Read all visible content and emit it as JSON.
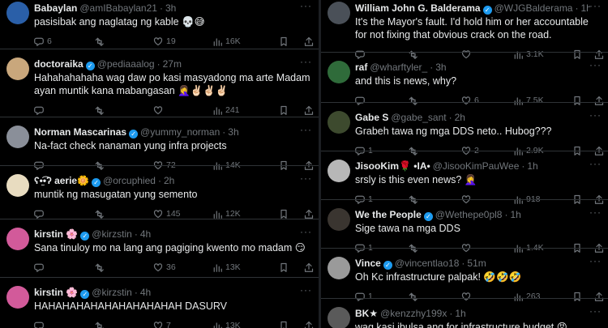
{
  "left_column": [
    {
      "name": "Babaylan",
      "verified": false,
      "handle": "@amIBabaylan21",
      "time": "3h",
      "text": "pasisibak ang naglatag ng kable 💀😅",
      "replies": "6",
      "reposts": "",
      "likes": "19",
      "views": "16K",
      "avatar_color": "#2a5fa8"
    },
    {
      "name": "doctoraika",
      "verified": true,
      "handle": "@pediaaalog",
      "time": "27m",
      "text": "Hahahahahaha wag daw po kasi masyadong ma arte Madam ayan muntik kana mabangasan 🤦‍♀️✌🏻✌🏻✌🏻",
      "replies": "",
      "reposts": "",
      "likes": "",
      "views": "241",
      "avatar_color": "#c9a77c"
    },
    {
      "name": "Norman Mascarinas",
      "verified": true,
      "handle": "@yummy_norman",
      "time": "3h",
      "text": "Na-fact check nanaman yung infra projects",
      "replies": "",
      "reposts": "",
      "likes": "72",
      "views": "14K",
      "avatar_color": "#8a8f99"
    },
    {
      "name": "ʕ•̫͡•ʔ aerie🌼",
      "verified": true,
      "handle": "@orcuphied",
      "time": "2h",
      "text": "muntik ng masugatan yung semento",
      "replies": "",
      "reposts": "",
      "likes": "145",
      "views": "12K",
      "avatar_color": "#e8dcc0"
    },
    {
      "name": "kirstin 🌸",
      "verified": true,
      "handle": "@kirzstin",
      "time": "4h",
      "text": "Sana tinuloy mo na lang ang pagiging kwento mo madam 😏",
      "replies": "",
      "reposts": "",
      "likes": "36",
      "views": "13K",
      "avatar_color": "#d25a9a"
    },
    {
      "name": "kirstin 🌸",
      "verified": true,
      "handle": "@kirzstin",
      "time": "4h",
      "text": "HAHAHAHAHAHAHAHAHAHAH DASURV",
      "replies": "",
      "reposts": "",
      "likes": "7",
      "views": "13K",
      "avatar_color": "#d25a9a"
    }
  ],
  "right_column": [
    {
      "name": "William John G. Balderama",
      "verified": true,
      "handle": "@WJGBalderama",
      "time": "1h",
      "text": "It's the Mayor's fault. I'd hold him or her accountable for not fixing that obvious crack on the road.",
      "replies": "",
      "reposts": "",
      "likes": "",
      "views": "3.1K",
      "avatar_color": "#4a5058"
    },
    {
      "name": "raf",
      "verified": false,
      "handle": "@wharftyler_",
      "time": "3h",
      "text": "and this is news, why?",
      "replies": "",
      "reposts": "",
      "likes": "6",
      "views": "7.5K",
      "avatar_color": "#2f6b3a"
    },
    {
      "name": "Gabe S",
      "verified": false,
      "handle": "@gabe_sant",
      "time": "2h",
      "text": "Grabeh tawa ng mga DDS neto.. Hubog???",
      "replies": "1",
      "reposts": "",
      "likes": "2",
      "views": "2.9K",
      "avatar_color": "#3d4a2e"
    },
    {
      "name": "JisooKim🌹 •IA•",
      "verified": false,
      "handle": "@JisooKimPauWee",
      "time": "1h",
      "text": "srsly is this even news? 🤦‍♀️",
      "replies": "1",
      "reposts": "",
      "likes": "",
      "views": "918",
      "avatar_color": "#b7b7b7"
    },
    {
      "name": "We the People",
      "verified": true,
      "handle": "@Wethepe0pl8",
      "time": "1h",
      "text": "Sige tawa na mga DDS",
      "replies": "1",
      "reposts": "",
      "likes": "",
      "views": "1.4K",
      "avatar_color": "#3a3530"
    },
    {
      "name": "Vince",
      "verified": true,
      "handle": "@vincentlao18",
      "time": "51m",
      "text": "Oh Kc infrastructure palpak! 🤣🤣🤣",
      "replies": "1",
      "reposts": "",
      "likes": "",
      "views": "263",
      "avatar_color": "#9a9a9a"
    },
    {
      "name": "BK★",
      "verified": false,
      "handle": "@kenzzhy199x",
      "time": "1h",
      "text": "wag kasi ibulsa ang for infrastructure budget 😡",
      "replies": "",
      "reposts": "",
      "likes": "",
      "views": "",
      "avatar_color": "#5a5a5a"
    }
  ],
  "icons": [
    "reply-icon",
    "repost-icon",
    "like-icon",
    "views-icon",
    "bookmark-icon",
    "share-icon",
    "verified-badge-icon",
    "more-icon"
  ],
  "colors": {
    "background": "#000000",
    "text": "#e7e9ea",
    "secondary": "#71767b",
    "verified": "#1d9bf0",
    "divider": "#2f3336"
  }
}
